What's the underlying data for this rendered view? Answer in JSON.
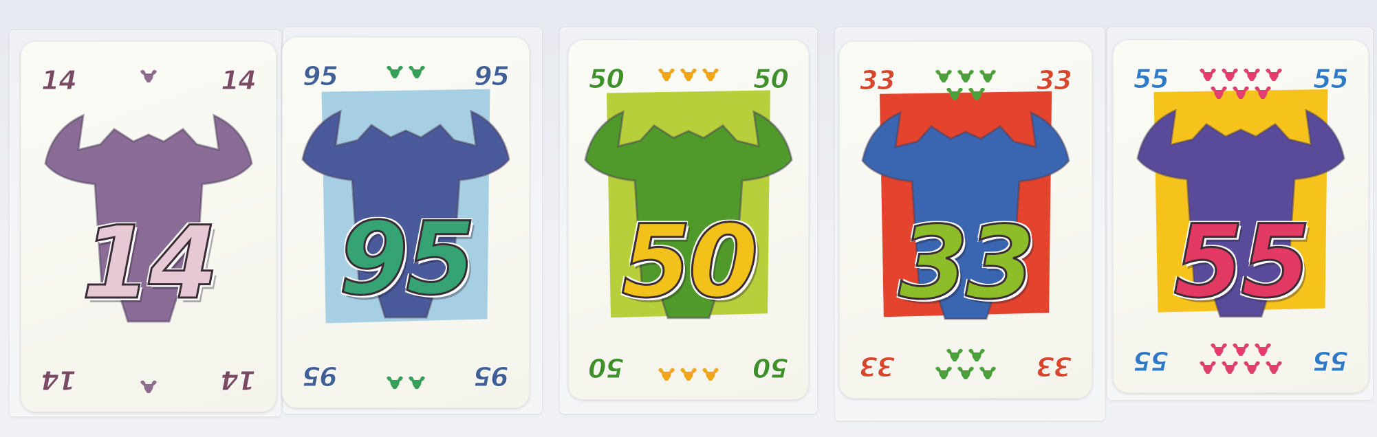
{
  "cards": [
    {
      "id": "card-14",
      "number": "14",
      "bulls": 1,
      "top_rows": [
        1
      ],
      "bottom_rows": [
        1
      ],
      "number_color": "#7a4a63",
      "big_fill": "#e6c9d4",
      "field_color": "#ffffff",
      "field_visible": false,
      "bull_color": "#8a6c96",
      "head_color": "#8e6c8e"
    },
    {
      "id": "card-95",
      "number": "95",
      "bulls": 2,
      "top_rows": [
        2
      ],
      "bottom_rows": [
        2
      ],
      "number_color": "#3f5f96",
      "big_fill": "#35a373",
      "field_color": "#a7cfe4",
      "field_visible": true,
      "bull_color": "#4a5a9a",
      "head_color": "#35a05a"
    },
    {
      "id": "card-50",
      "number": "50",
      "bulls": 3,
      "top_rows": [
        3
      ],
      "bottom_rows": [
        3
      ],
      "number_color": "#3f8f2a",
      "big_fill": "#f3c21a",
      "field_color": "#b6cf3a",
      "field_visible": true,
      "bull_color": "#4f9a2a",
      "head_color": "#f0a51c"
    },
    {
      "id": "card-33",
      "number": "33",
      "bulls": 5,
      "top_rows": [
        3,
        2
      ],
      "bottom_rows": [
        2,
        3
      ],
      "number_color": "#d8452a",
      "big_fill": "#8ebd2a",
      "field_color": "#e4442e",
      "field_visible": true,
      "bull_color": "#3a65b0",
      "head_color": "#4aa03a"
    },
    {
      "id": "card-55",
      "number": "55",
      "bulls": 7,
      "top_rows": [
        4,
        3
      ],
      "bottom_rows": [
        3,
        4
      ],
      "number_color": "#2e7ac7",
      "big_fill": "#e23a63",
      "field_color": "#f6c21c",
      "field_visible": true,
      "bull_color": "#5a4a9a",
      "head_color": "#e0406e"
    }
  ]
}
